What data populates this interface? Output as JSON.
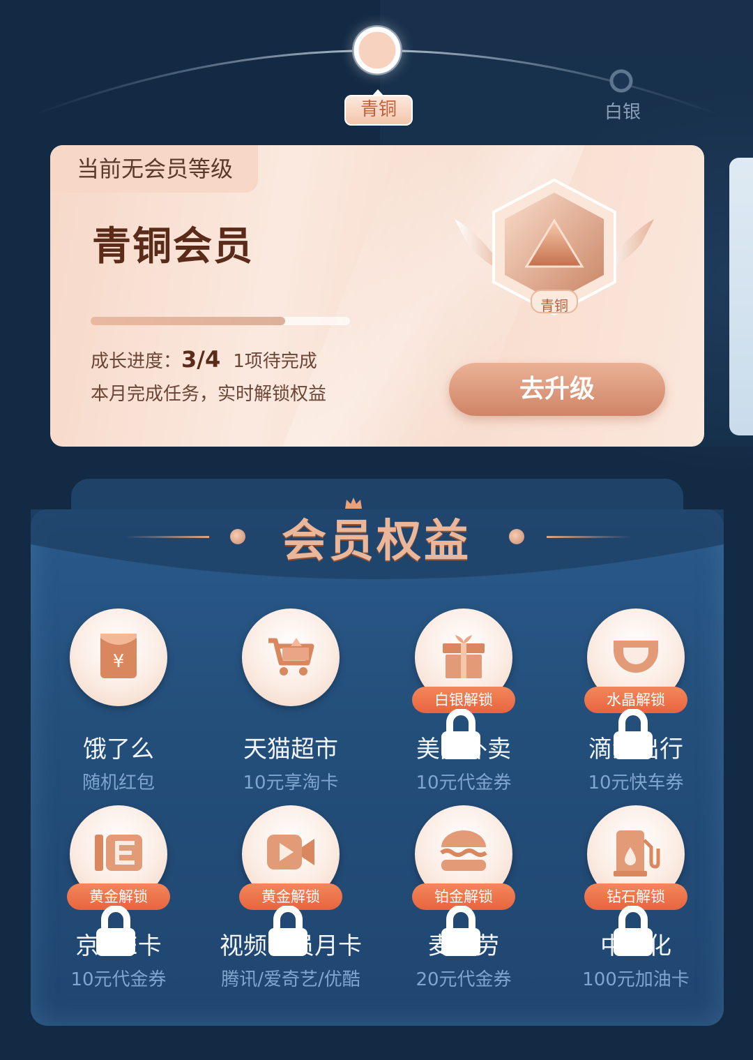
{
  "levels": {
    "current_label": "青铜",
    "next_label": "白银"
  },
  "card": {
    "tag": "当前无会员等级",
    "title": "青铜会员",
    "badge_label": "青铜",
    "progress_fraction": 0.75,
    "growth_label": "成长进度：",
    "growth_value": "3/4",
    "pending": "1项待完成",
    "subtitle": "本月完成任务，实时解锁权益",
    "upgrade_button": "去升级"
  },
  "benefits": {
    "title": "会员权益",
    "items": [
      {
        "name": "饿了么",
        "desc": "随机红包",
        "icon": "red-envelope-icon",
        "lock": ""
      },
      {
        "name": "天猫超市",
        "desc": "10元享淘卡",
        "icon": "shopping-cart-icon",
        "lock": ""
      },
      {
        "name": "美团外卖",
        "desc": "10元代金券",
        "icon": "gift-icon",
        "lock": "白银解锁"
      },
      {
        "name": "滴滴出行",
        "desc": "10元快车券",
        "icon": "didi-icon",
        "lock": "水晶解锁"
      },
      {
        "name": "京东E卡",
        "desc": "10元代金券",
        "icon": "ecard-icon",
        "lock": "黄金解锁"
      },
      {
        "name": "视频会员月卡",
        "desc": "腾讯/爱奇艺/优酷",
        "icon": "video-camera-icon",
        "lock": "黄金解锁"
      },
      {
        "name": "麦当劳",
        "desc": "20元代金券",
        "icon": "burger-icon",
        "lock": "铂金解锁"
      },
      {
        "name": "中石化",
        "desc": "100元加油卡",
        "icon": "fuel-pump-icon",
        "lock": "钻石解锁"
      }
    ]
  },
  "colors": {
    "background": "#132a44",
    "card": "#f6d8c8",
    "accent": "#cf8466",
    "lock_pill": "#e8643e",
    "panel": "#244f7b"
  }
}
